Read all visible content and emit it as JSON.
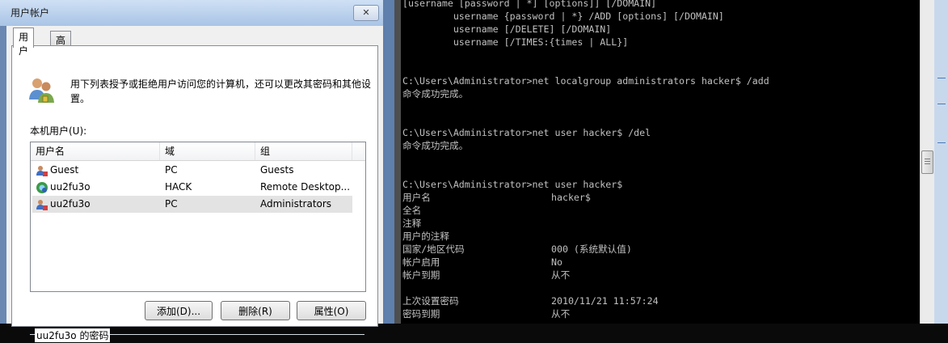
{
  "dialog": {
    "title": "用户帐户",
    "tabs": [
      {
        "label": "用户",
        "active": true
      },
      {
        "label": "高级",
        "active": false
      }
    ],
    "intro": "用下列表授予或拒绝用户访问您的计算机，还可以更改其密码和其他设置。",
    "local_users_label": "本机用户(U):",
    "columns": [
      "用户名",
      "域",
      "组"
    ],
    "rows": [
      {
        "name": "Guest",
        "domain": "PC",
        "group": "Guests",
        "icon": "user-icon",
        "selected": false
      },
      {
        "name": "uu2fu3o",
        "domain": "HACK",
        "group": "Remote Desktop...",
        "icon": "domain-user-icon",
        "selected": false
      },
      {
        "name": "uu2fu3o",
        "domain": "PC",
        "group": "Administrators",
        "icon": "user-icon",
        "selected": true
      }
    ],
    "buttons": {
      "add": "添加(D)...",
      "remove": "删除(R)",
      "properties": "属性(O)"
    },
    "password_group_label": "uu2fu3o 的密码"
  },
  "console": {
    "lines": [
      {
        "text": "[username [password | *] [options]] [/DOMAIN]"
      },
      {
        "text": "         username {password | *} /ADD [options] [/DOMAIN]"
      },
      {
        "text": "         username [/DELETE] [/DOMAIN]"
      },
      {
        "text": "         username [/TIMES:{times | ALL}]"
      },
      {
        "text": ""
      },
      {
        "text": ""
      },
      {
        "text": "C:\\Users\\Administrator>net localgroup administrators hacker$ /add"
      },
      {
        "text": "命令成功完成。"
      },
      {
        "text": ""
      },
      {
        "text": ""
      },
      {
        "text": "C:\\Users\\Administrator>net user hacker$ /del"
      },
      {
        "text": "命令成功完成。"
      },
      {
        "text": ""
      },
      {
        "text": ""
      },
      {
        "text": "C:\\Users\\Administrator>net user hacker$"
      },
      {
        "text": "用户名",
        "value": "hacker$"
      },
      {
        "text": "全名"
      },
      {
        "text": "注释"
      },
      {
        "text": "用户的注释"
      },
      {
        "text": "国家/地区代码",
        "value": "000 (系统默认值)"
      },
      {
        "text": "帐户启用",
        "value": "No"
      },
      {
        "text": "帐户到期",
        "value": "从不"
      },
      {
        "text": ""
      },
      {
        "text": "上次设置密码",
        "value": "2010/11/21 11:57:24"
      },
      {
        "text": "密码到期",
        "value": "从不"
      }
    ]
  },
  "colors": {
    "console_bg": "#000000",
    "console_text": "#c0c0c0",
    "dialog_frame": "#6a88b2"
  }
}
